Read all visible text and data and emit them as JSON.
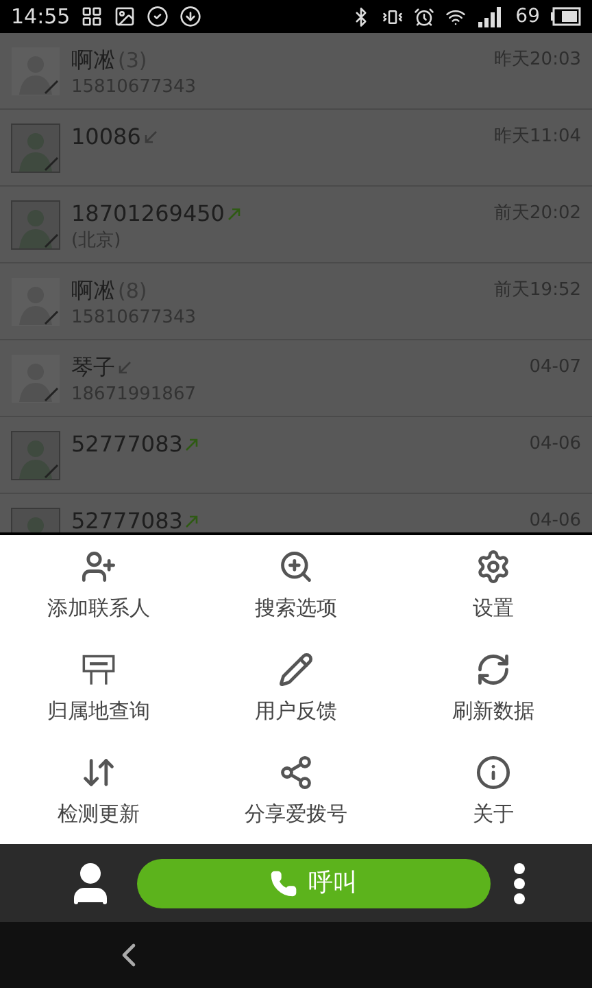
{
  "status_bar": {
    "time": "14:55",
    "battery": "69"
  },
  "calls": [
    {
      "name": "啊凇",
      "count": "(3)",
      "detail": "15810677343",
      "time": "昨天20:03",
      "kind": "plain",
      "saved_contact": true
    },
    {
      "name": "10086",
      "kind": "incoming",
      "time": "昨天11:04",
      "saved_contact": false
    },
    {
      "name": "18701269450",
      "kind": "outgoing",
      "detail": "(北京)",
      "time": "前天20:02",
      "saved_contact": false
    },
    {
      "name": "啊凇",
      "count": "(8)",
      "detail": "15810677343",
      "time": "前天19:52",
      "kind": "plain",
      "saved_contact": true
    },
    {
      "name": "琴子",
      "kind": "incoming",
      "detail": "18671991867",
      "time": "04-07",
      "saved_contact": true
    },
    {
      "name": "52777083",
      "kind": "outgoing",
      "time": "04-06",
      "saved_contact": false
    },
    {
      "name": "52777083",
      "kind": "outgoing",
      "time": "04-06",
      "saved_contact": false
    }
  ],
  "menu": [
    {
      "kind": "add-contact",
      "label": "添加联系人"
    },
    {
      "kind": "search-add",
      "label": "搜索选项"
    },
    {
      "kind": "settings",
      "label": "设置"
    },
    {
      "kind": "area-code",
      "label": "归属地查询"
    },
    {
      "kind": "feedback",
      "label": "用户反馈"
    },
    {
      "kind": "refresh",
      "label": "刷新数据"
    },
    {
      "kind": "update",
      "label": "检测更新"
    },
    {
      "kind": "share",
      "label": "分享爱拨号"
    },
    {
      "kind": "about",
      "label": "关于"
    }
  ],
  "call_button": {
    "label": "呼叫"
  }
}
